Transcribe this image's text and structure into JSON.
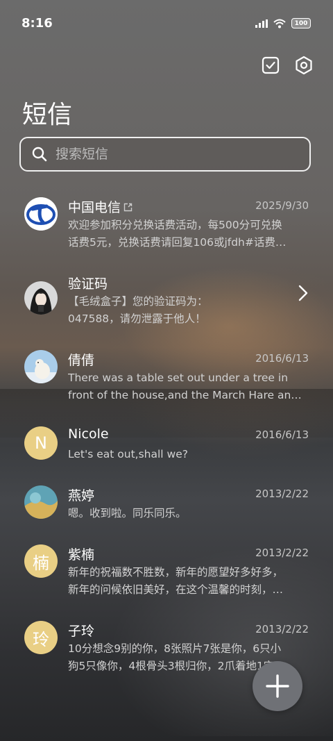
{
  "status": {
    "time": "8:16",
    "battery": "100"
  },
  "title": "短信",
  "search": {
    "placeholder": "搜索短信"
  },
  "messages": [
    {
      "name": "中国电信",
      "date": "2025/9/30",
      "line1": "欢迎参加积分兑换话费活动，每500分可兑换",
      "line2": "话费5元，兑换话费请回复106或jfdh#话费…"
    },
    {
      "name": "验证码",
      "date": "",
      "line1": "【毛绒盒子】您的验证码为：",
      "line2": "047588，请勿泄露于他人！"
    },
    {
      "name": "倩倩",
      "date": "2016/6/13",
      "line1": "There was a table set out under a tree in",
      "line2": "front of the house,and the March Hare an…"
    },
    {
      "name": "Nicole",
      "date": "2016/6/13",
      "avatar_letter": "N",
      "line1": "Let's eat out,shall we?",
      "line2": ""
    },
    {
      "name": "燕婷",
      "date": "2013/2/22",
      "line1": "嗯。收到啦。同乐同乐。",
      "line2": ""
    },
    {
      "name": "紫楠",
      "date": "2013/2/22",
      "avatar_letter": "楠",
      "line1": "新年的祝福数不胜数，新年的愿望好多好多，",
      "line2": "新年的问候依旧美好，在这个温馨的时刻，…"
    },
    {
      "name": "子玲",
      "date": "2013/2/22",
      "avatar_letter": "玲",
      "line1": "10分想念9别的你，8张照片7张是你，6只小",
      "line2": "狗5只像你，4根骨头3根归你，2爪着地1定…"
    }
  ],
  "colors": {
    "accent": "#e9cf85",
    "fab": "#6f7176"
  }
}
